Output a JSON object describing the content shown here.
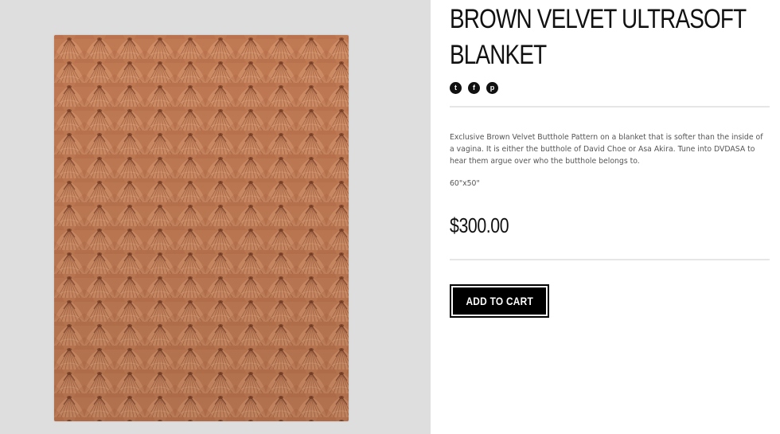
{
  "product": {
    "title": "BROWN VELVET ULTRASOFT BLANKET",
    "description": "Exclusive Brown Velvet Butthole Pattern on a blanket that is softer than the inside of a vagina. It is either the butthole of David Choe or Asa Akira. Tune into DVDASA to hear them argue over who the butthole belongs to.",
    "size": "60\"x50\"",
    "price": "$300.00",
    "image_alt": "Brown velvet blanket with repeating radial pattern"
  },
  "share": {
    "icons": [
      "twitter-icon",
      "facebook-icon",
      "pinterest-icon"
    ],
    "glyphs": [
      "t",
      "f",
      "p"
    ]
  },
  "cart": {
    "button_label": "ADD TO CART"
  },
  "colors": {
    "image_panel_bg": "#dedede",
    "blanket_base": "#c77d55",
    "blanket_dark": "#8a4a2e",
    "blanket_light": "#e6a47a",
    "text_primary": "#111111",
    "text_secondary": "#555555",
    "button_bg": "#000000"
  }
}
